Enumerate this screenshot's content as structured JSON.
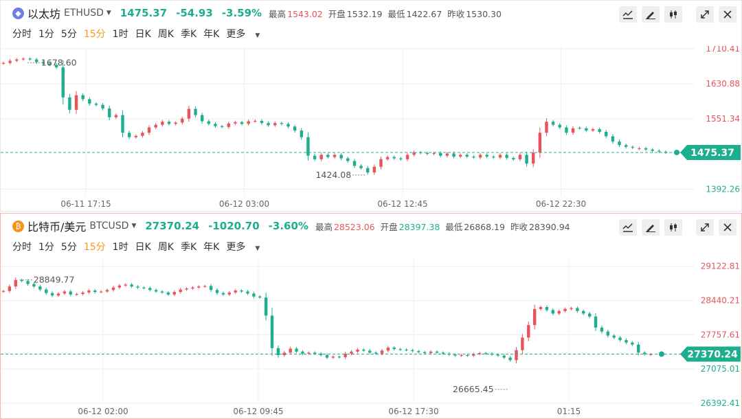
{
  "colors": {
    "up": "#e8545b",
    "down": "#1cae8f",
    "active_tf": "#f39a1e",
    "grid": "#eeeeee"
  },
  "panels": [
    {
      "coin_icon": "ethereum-icon",
      "icon_color": "#6f7fe3",
      "name": "以太坊",
      "symbol": "ETHUSD",
      "price": "1475.37",
      "change": "-54.93",
      "change_pct": "-3.59%",
      "price_color": "#1cae8f",
      "stats": [
        {
          "label": "最高",
          "value": "1543.02",
          "color": "#e8545b"
        },
        {
          "label": "开盘",
          "value": "1532.19",
          "color": "#555555"
        },
        {
          "label": "最低",
          "value": "1422.67",
          "color": "#555555"
        },
        {
          "label": "昨收",
          "value": "1530.30",
          "color": "#555555"
        }
      ],
      "timeframes": [
        "分时",
        "1分",
        "5分",
        "15分",
        "1时",
        "日K",
        "周K",
        "季K",
        "年K",
        "更多"
      ],
      "active_timeframe": "15分"
    },
    {
      "coin_icon": "bitcoin-icon",
      "icon_color": "#f7931a",
      "name": "比特币/美元",
      "symbol": "BTCUSD",
      "price": "27370.24",
      "change": "-1020.70",
      "change_pct": "-3.60%",
      "price_color": "#1cae8f",
      "stats": [
        {
          "label": "最高",
          "value": "28523.06",
          "color": "#e8545b"
        },
        {
          "label": "开盘",
          "value": "28397.38",
          "color": "#1cae8f"
        },
        {
          "label": "最低",
          "value": "26868.19",
          "color": "#555555"
        },
        {
          "label": "昨收",
          "value": "28390.94",
          "color": "#555555"
        }
      ],
      "timeframes": [
        "分时",
        "1分",
        "5分",
        "15分",
        "1时",
        "日K",
        "周K",
        "季K",
        "年K",
        "更多"
      ],
      "active_timeframe": "15分"
    }
  ],
  "chart_data": [
    {
      "type": "candlestick",
      "title": "",
      "interval": "15分",
      "x_ticks": [
        "06-11 17:15",
        "06-12 03:00",
        "06-12 12:45",
        "06-12 22:30"
      ],
      "y_ticks": [
        1710.41,
        1630.88,
        1551.34,
        1392.26
      ],
      "ylim": [
        1377.3,
        1716.4
      ],
      "current_price": 1475.37,
      "annotations": [
        {
          "text": "1678.60",
          "value": 1678.6
        },
        {
          "text": "1424.08",
          "value": 1424.08
        }
      ],
      "grid": true,
      "path": [
        1678,
        1683,
        1686,
        1688,
        1686,
        1680,
        1677,
        1674,
        1668,
        1600,
        1572,
        1605,
        1596,
        1586,
        1583,
        1575,
        1555,
        1560,
        1520,
        1510,
        1513,
        1520,
        1532,
        1538,
        1545,
        1540,
        1543,
        1552,
        1574,
        1560,
        1546,
        1540,
        1535,
        1533,
        1541,
        1544,
        1540,
        1546,
        1547,
        1542,
        1537,
        1542,
        1540,
        1534,
        1525,
        1510,
        1468,
        1460,
        1470,
        1465,
        1470,
        1462,
        1456,
        1445,
        1440,
        1430,
        1443,
        1460,
        1465,
        1462,
        1460,
        1470,
        1476,
        1474,
        1472,
        1474,
        1468,
        1473,
        1466,
        1470,
        1466,
        1464,
        1470,
        1466,
        1464,
        1470,
        1463,
        1460,
        1470,
        1450,
        1475,
        1520,
        1545,
        1538,
        1532,
        1520,
        1530,
        1530,
        1525,
        1528,
        1522,
        1512,
        1500,
        1492,
        1488,
        1486,
        1485,
        1482,
        1479,
        1477,
        1475
      ]
    },
    {
      "type": "candlestick",
      "title": "",
      "interval": "15分",
      "x_ticks": [
        "06-12 02:00",
        "06-12 09:45",
        "06-12 17:30",
        "01:15"
      ],
      "y_ticks": [
        29122.81,
        28440.21,
        27757.61,
        27075.01,
        26392.41
      ],
      "ylim": [
        26390.0,
        29270.0
      ],
      "current_price": 27370.24,
      "annotations": [
        {
          "text": "28849.77",
          "value": 28849.77
        },
        {
          "text": "26665.45",
          "value": 26665.45
        }
      ],
      "grid": true,
      "path": [
        28630,
        28720,
        28850,
        28830,
        28770,
        28720,
        28660,
        28590,
        28540,
        28580,
        28620,
        28560,
        28570,
        28600,
        28640,
        28610,
        28620,
        28650,
        28700,
        28740,
        28760,
        28720,
        28700,
        28690,
        28650,
        28620,
        28600,
        28560,
        28610,
        28660,
        28680,
        28700,
        28720,
        28730,
        28650,
        28590,
        28560,
        28600,
        28640,
        28620,
        28580,
        28520,
        28500,
        28140,
        27490,
        27350,
        27400,
        27480,
        27420,
        27380,
        27400,
        27380,
        27350,
        27300,
        27320,
        27310,
        27380,
        27420,
        27460,
        27440,
        27400,
        27380,
        27440,
        27500,
        27470,
        27460,
        27450,
        27430,
        27410,
        27390,
        27420,
        27400,
        27380,
        27360,
        27340,
        27350,
        27340,
        27370,
        27390,
        27380,
        27360,
        27340,
        27300,
        27250,
        27450,
        27700,
        27950,
        28270,
        28310,
        28250,
        28180,
        28230,
        28270,
        28290,
        28230,
        28180,
        28120,
        27900,
        27820,
        27740,
        27700,
        27650,
        27600,
        27560,
        27400,
        27370,
        27370
      ]
    }
  ]
}
